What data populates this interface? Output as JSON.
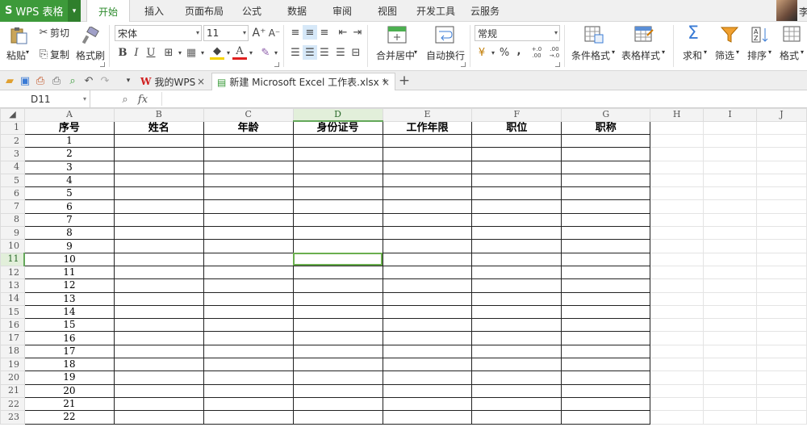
{
  "app": {
    "title": "WPS 表格",
    "caret": "▾"
  },
  "menu_tabs": [
    {
      "label": "开始",
      "active": true
    },
    {
      "label": "插入"
    },
    {
      "label": "页面布局"
    },
    {
      "label": "公式"
    },
    {
      "label": "数据"
    },
    {
      "label": "审阅"
    },
    {
      "label": "视图"
    },
    {
      "label": "开发工具"
    },
    {
      "label": "云服务"
    }
  ],
  "user": {
    "name_fragment": "李"
  },
  "ribbon": {
    "paste": "粘贴",
    "cut": "剪切",
    "copy": "复制",
    "format_painter": "格式刷",
    "font_name": "宋体",
    "font_size": "11",
    "bold": "B",
    "italic": "I",
    "underline": "U",
    "merge_center": "合并居中",
    "wrap_text": "自动换行",
    "number_format": "常规",
    "percent": "%",
    "comma": ",",
    "inc_decimal": "+.0 .00",
    "dec_decimal": ".00 →.0",
    "conditional_format": "条件格式",
    "table_style": "表格样式",
    "sum": "求和",
    "filter": "筛选",
    "sort": "排序",
    "format": "格式"
  },
  "doc_tabs": [
    {
      "label": "我的WPS",
      "close": "×"
    },
    {
      "label": "新建 Microsoft Excel 工作表.xlsx *",
      "close": "×",
      "active": true
    }
  ],
  "add_tab": "+",
  "formula_bar": {
    "name_box": "D11",
    "fx": "fx",
    "formula": ""
  },
  "sheet": {
    "columns": [
      "A",
      "B",
      "C",
      "D",
      "E",
      "F",
      "G",
      "H",
      "I",
      "J"
    ],
    "selected_column": "D",
    "selected_row": 11,
    "active_cell": "D11",
    "headers": [
      "序号",
      "姓名",
      "年龄",
      "身份证号",
      "工作年限",
      "职位",
      "职称"
    ],
    "row_numbers": [
      1,
      2,
      3,
      4,
      5,
      6,
      7,
      8,
      9,
      10,
      11,
      12,
      13,
      14,
      15,
      16,
      17,
      18,
      19,
      20,
      21,
      22,
      23
    ],
    "serials": [
      "1",
      "2",
      "3",
      "4",
      "5",
      "6",
      "7",
      "8",
      "9",
      "10",
      "11",
      "12",
      "13",
      "14",
      "15",
      "16",
      "17",
      "18",
      "19",
      "20",
      "21",
      "22"
    ]
  },
  "colors": {
    "brand_green": "#3d9a3a",
    "selection_green": "#6aae4e",
    "active_tab_text": "#2b8a2b"
  }
}
